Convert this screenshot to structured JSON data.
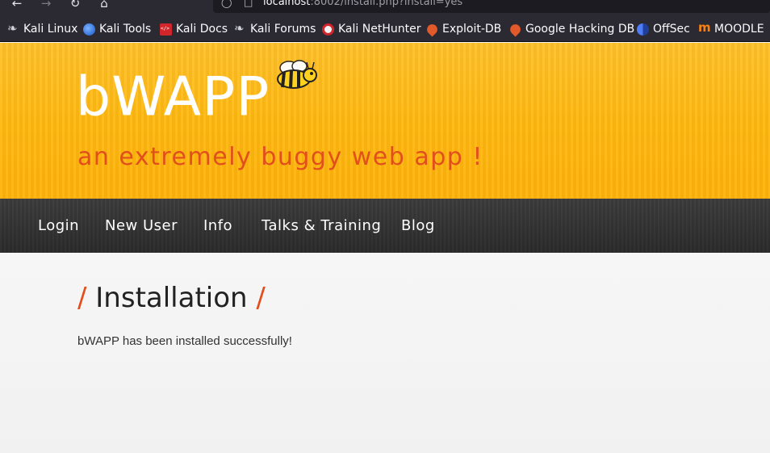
{
  "browser": {
    "url_host": "localhost",
    "url_rest": ":8002/install.php?install=yes",
    "bookmarks": [
      {
        "label": "Kali Linux",
        "icon": "kali-dragon-icon"
      },
      {
        "label": "Kali Tools",
        "icon": "kali-tools-icon"
      },
      {
        "label": "Kali Docs",
        "icon": "kali-docs-icon"
      },
      {
        "label": "Kali Forums",
        "icon": "kali-dragon-icon"
      },
      {
        "label": "Kali NetHunter",
        "icon": "nethunter-icon"
      },
      {
        "label": "Exploit-DB",
        "icon": "exploit-db-icon"
      },
      {
        "label": "Google Hacking DB",
        "icon": "ghdb-icon"
      },
      {
        "label": "OffSec",
        "icon": "offsec-icon"
      },
      {
        "label": "MOODLE",
        "icon": "moodle-icon"
      }
    ]
  },
  "header": {
    "logo": "bWAPP",
    "tagline": "an extremely buggy web app !"
  },
  "menu": {
    "items": [
      "Login",
      "New User",
      "Info",
      "Talks & Training",
      "Blog"
    ]
  },
  "main": {
    "title": "Installation",
    "slash": "/",
    "message": "bWAPP has been installed successfully!"
  },
  "colors": {
    "header_yellow": "#ffb80f",
    "tagline_orange": "#e14f1d",
    "menu_dark": "#333333",
    "content_bg": "#f3f3f3"
  }
}
